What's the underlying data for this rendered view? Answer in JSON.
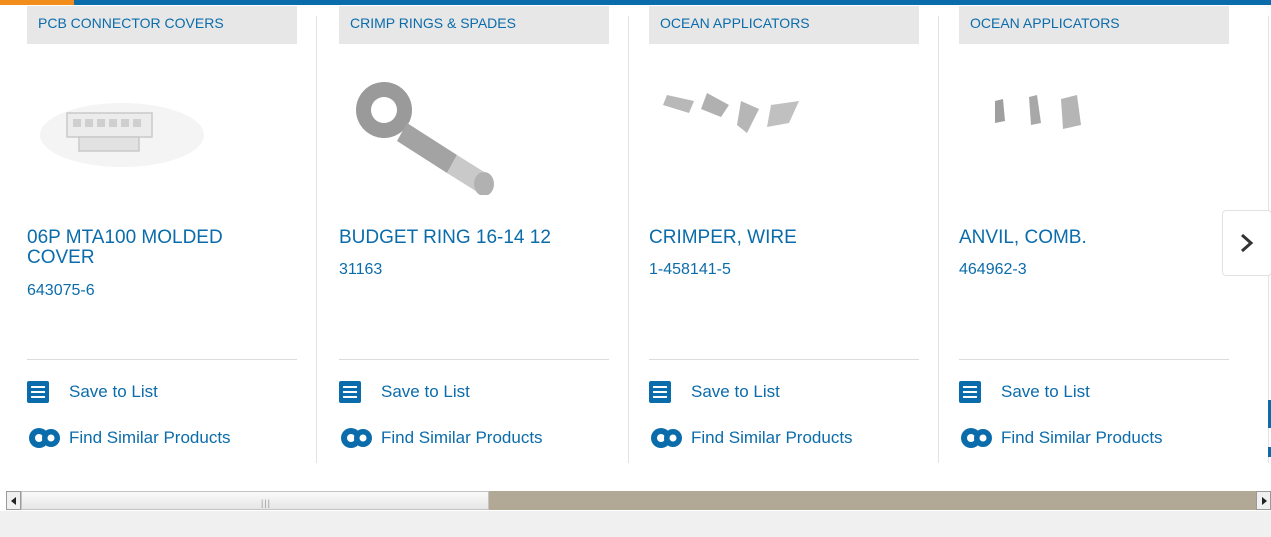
{
  "cards": [
    {
      "category": "PCB CONNECTOR COVERS",
      "title": "06P MTA100 MOLDED COVER",
      "part_number": "643075-6",
      "save_label": "Save to List",
      "similar_label": "Find Similar Products"
    },
    {
      "category": "CRIMP RINGS & SPADES",
      "title": "BUDGET RING 16-14 12",
      "part_number": "31163",
      "save_label": "Save to List",
      "similar_label": "Find Similar Products"
    },
    {
      "category": "OCEAN APPLICATORS",
      "title": "CRIMPER, WIRE",
      "part_number": "1-458141-5",
      "save_label": "Save to List",
      "similar_label": "Find Similar Products"
    },
    {
      "category": "OCEAN APPLICATORS",
      "title": "ANVIL, COMB.",
      "part_number": "464962-3",
      "save_label": "Save to List",
      "similar_label": "Find Similar Products"
    }
  ],
  "icons": {
    "next": "chevron-right-icon",
    "save": "checklist-icon",
    "similar": "gears-icon"
  },
  "colors": {
    "brand_blue": "#0b6cab",
    "accent_orange": "#f28c1b",
    "chip_gray": "#e7e7e7"
  }
}
